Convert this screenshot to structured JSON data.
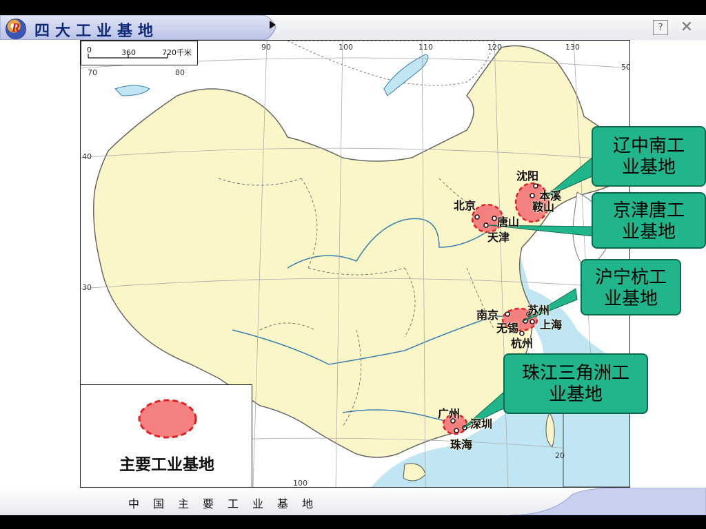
{
  "window": {
    "title": "四大工业基地",
    "logo_letter": "R",
    "help_label": "?",
    "close_label": "✕",
    "icons": [
      "logo-icon",
      "play-icon",
      "help-icon",
      "close-icon"
    ]
  },
  "footer": {
    "title": "中国主要工业基地"
  },
  "map": {
    "scale": {
      "ticks": [
        "0",
        "360",
        "720千米"
      ]
    },
    "coords": {
      "longitudes": [
        "90",
        "100",
        "110",
        "120",
        "130",
        "80",
        "70",
        "100"
      ],
      "latitudes": [
        "50",
        "40",
        "30",
        "20"
      ]
    },
    "legend": {
      "label": "主要工业基地",
      "swatch_color": "#f48080",
      "border_color": "#e02020"
    },
    "cities": {
      "shenyang": "沈阳",
      "benxi": "本溪",
      "anshan": "鞍山",
      "beijing": "北京",
      "tangshan": "唐山",
      "tianjin": "天津",
      "nanjing": "南京",
      "suzhou": "苏州",
      "wuxi": "无锡",
      "shanghai": "上海",
      "hangzhou": "杭州",
      "guangzhou": "广州",
      "shenzhen": "深圳",
      "zhuhai": "珠海"
    },
    "callouts": {
      "liaozhongnan": "辽中南工业基地",
      "jingjintang": "京津唐工业基地",
      "huninghang": "沪宁杭工业基地",
      "zhujiang": "珠江三角洲工业基地"
    },
    "colors": {
      "land": "#fbf6c8",
      "sea": "#bfe6f2",
      "callout": "#20b58a",
      "base_fill": "#f48080"
    }
  }
}
